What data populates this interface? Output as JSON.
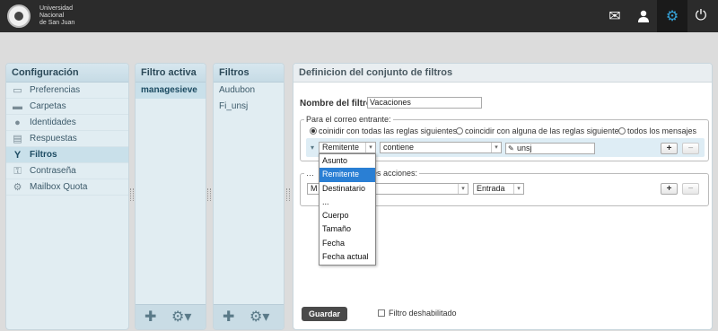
{
  "header": {
    "logo_lines": [
      "Universidad",
      "Nacional",
      "de San Juan"
    ],
    "icons": [
      "mail-icon",
      "user-icon",
      "settings-icon",
      "power-icon"
    ],
    "active_icon": "settings-icon",
    "accent": "#36a3d9"
  },
  "config_panel": {
    "title": "Configuración",
    "items": [
      {
        "label": "Preferencias",
        "icon": "monitor-icon"
      },
      {
        "label": "Carpetas",
        "icon": "folder-icon"
      },
      {
        "label": "Identidades",
        "icon": "person-icon"
      },
      {
        "label": "Respuestas",
        "icon": "document-icon"
      },
      {
        "label": "Filtros",
        "icon": "filter-icon"
      },
      {
        "label": "Contraseña",
        "icon": "key-icon"
      },
      {
        "label": "Mailbox Quota",
        "icon": "gear-icon"
      }
    ],
    "selected_index": 4
  },
  "active_filter_panel": {
    "title": "Filtro activa",
    "items": [
      "managesieve"
    ]
  },
  "filters_panel": {
    "title": "Filtros",
    "items": [
      "Audubon",
      "Fi_unsj"
    ]
  },
  "main": {
    "title": "Definicion del conjunto de filtros",
    "filter_name_label": "Nombre del filtro:",
    "filter_name_value": "Vacaciones",
    "incoming_legend": "Para el correo entrante:",
    "match_options": [
      {
        "label": "coinidir con todas las reglas siguientes",
        "checked": true
      },
      {
        "label": "coincidir con alguna de las reglas siguientes",
        "checked": false
      },
      {
        "label": "todos los mensajes",
        "checked": false
      }
    ],
    "rule": {
      "header_value": "Remitente",
      "operator_value": "contiene",
      "target_value": "unsj",
      "add_label": "+",
      "remove_label": "−"
    },
    "actions_legend_visible": "… ",
    "actions_legend_tail": "antes acciones:",
    "action": {
      "type_value": "M",
      "folder_value": "Entrada",
      "add_label": "+",
      "remove_label": "−"
    },
    "dropdown_options": [
      "Asunto",
      "Remitente",
      "Destinatario",
      "...",
      "Cuerpo",
      "Tamaño",
      "Fecha",
      "Fecha actual"
    ],
    "dropdown_selected_index": 1,
    "save_label": "Guardar",
    "disabled_label": "Filtro deshabilitado",
    "disabled_checked": false
  }
}
